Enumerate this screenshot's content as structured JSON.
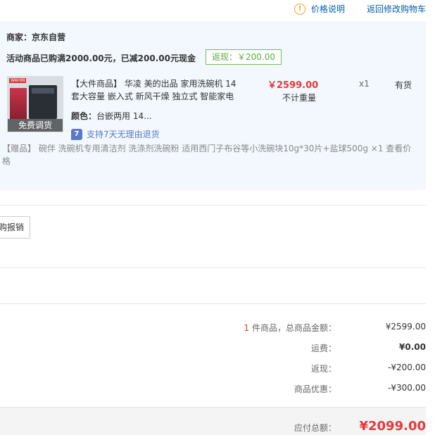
{
  "top": {
    "price_help_icon_glyph": "!",
    "price_help_label": "价格说明",
    "back_link": "返回修改购物车"
  },
  "order": {
    "merchant": "商家：京东自营",
    "promo": "活动商品已购满2000.00元，已减200.00元现金",
    "rebate_tag": "返现：￥200.00",
    "product": {
      "thumb_brand": "WAHIN",
      "thumb_overlay": "免费调货",
      "title": "【大件商品】 华凌 美的出品 家用洗碗机 14套大容量 嵌入式 新风干燥 独立式 智能家电",
      "price": "￥2599.00",
      "not_qty": "不计重量",
      "qty": "x1",
      "stock": "有货",
      "color_label": "颜色：",
      "color_value": "台嵌两用 14...",
      "return_icon_glyph": "7",
      "return_label": "支持7天无理由退货"
    },
    "gift": "【赠品】  碗伴 洗碗机专用清洁剂 洗涤剂洗碗粉 适用西门子布谷等小洗碗块10g*30片+盐球500g ×1  查看价格"
  },
  "reimb_button": "购报销",
  "summary": {
    "count": "1",
    "goods_label": "件商品，总商品金额：",
    "goods_value": "¥2599.00",
    "shipping_label": "运费：",
    "shipping_value": "¥0.00",
    "rebate_label": "返现：",
    "rebate_value": "-¥200.00",
    "discount_label": "商品优惠：",
    "discount_value": "-¥300.00",
    "total_label": "应付总额：",
    "total_value": "¥2099.00"
  },
  "colors": {
    "accent_red": "#e4393c",
    "link_blue": "#005ea7",
    "panel_bg": "#f3f8fe",
    "rebate_green": "#5aa947"
  }
}
